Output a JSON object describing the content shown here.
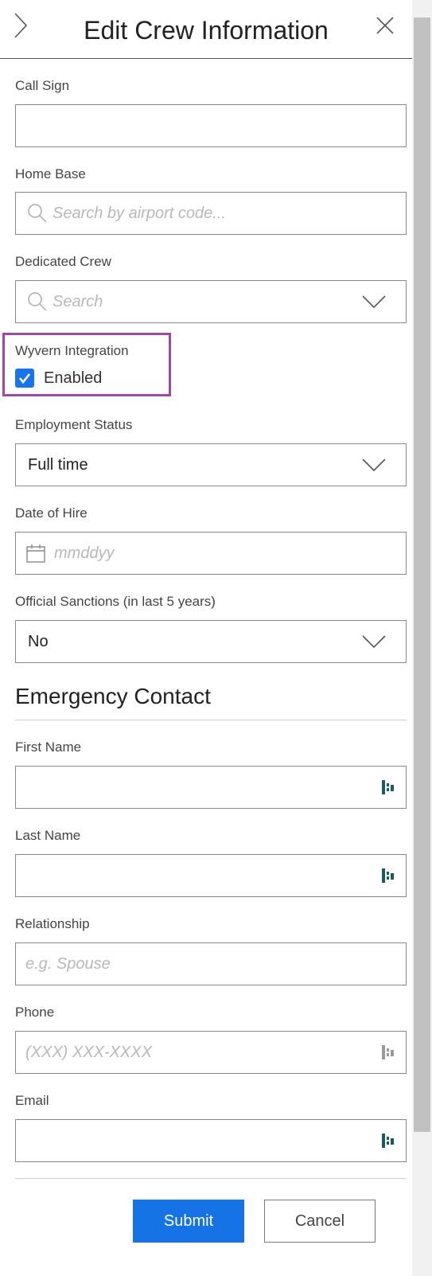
{
  "header": {
    "title": "Edit Crew Information",
    "expand_icon": "chevron-right-icon",
    "close_icon": "close-icon"
  },
  "fields": {
    "call_sign": {
      "label": "Call Sign",
      "value": ""
    },
    "home_base": {
      "label": "Home Base",
      "placeholder": "Search by airport code...",
      "icon": "search-icon"
    },
    "dedicated_crew": {
      "label": "Dedicated Crew",
      "placeholder": "Search",
      "icon": "search-icon"
    },
    "wyvern": {
      "label": "Wyvern Integration",
      "checkbox_label": "Enabled",
      "checked": true
    },
    "employment_status": {
      "label": "Employment Status",
      "value": "Full time"
    },
    "date_of_hire": {
      "label": "Date of Hire",
      "placeholder": "mmddyy",
      "icon": "calendar-icon"
    },
    "sanctions": {
      "label": "Official Sanctions (in last 5 years)",
      "value": "No"
    }
  },
  "emergency": {
    "title": "Emergency Contact",
    "first_name": {
      "label": "First Name",
      "value": ""
    },
    "last_name": {
      "label": "Last Name",
      "value": ""
    },
    "relationship": {
      "label": "Relationship",
      "placeholder": "e.g. Spouse"
    },
    "phone": {
      "label": "Phone",
      "placeholder": "(XXX) XXX-XXXX"
    },
    "email": {
      "label": "Email",
      "value": ""
    }
  },
  "actions": {
    "submit": "Submit",
    "cancel": "Cancel"
  },
  "colors": {
    "accent": "#1573e6",
    "highlight": "#9b4aa6",
    "autofill_icon": "#1b5c63"
  }
}
